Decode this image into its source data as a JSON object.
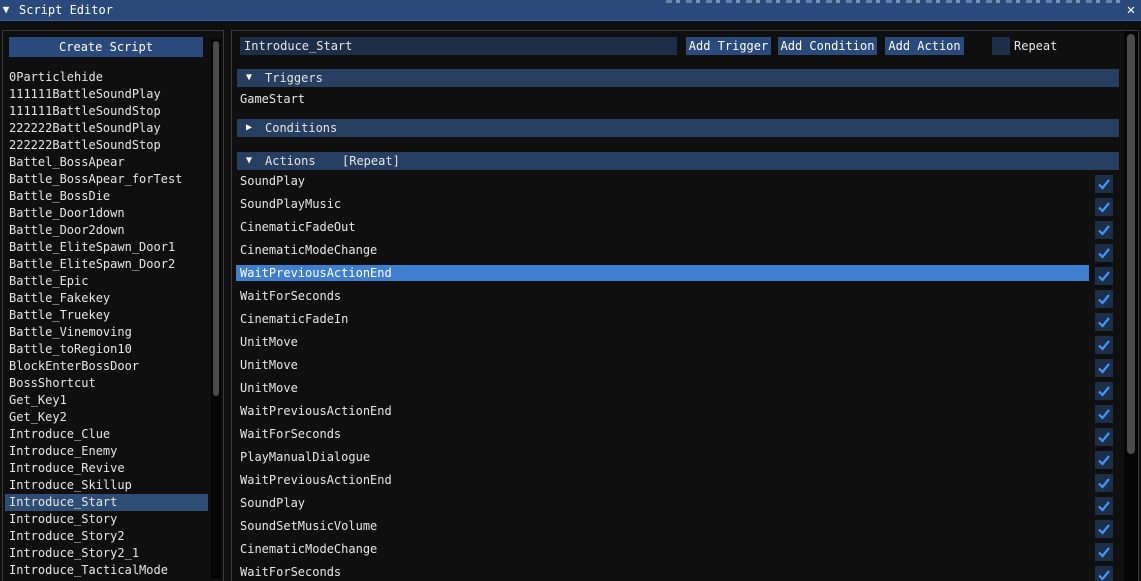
{
  "window": {
    "title": "Script Editor",
    "collapse_icon": "triangle-down",
    "close_icon": "x",
    "accent_color": "#294a7a"
  },
  "left": {
    "create_button": "Create Script",
    "scripts": [
      "0Particlehide",
      "111111BattleSoundPlay",
      "111111BattleSoundStop",
      "222222BattleSoundPlay",
      "222222BattleSoundStop",
      "Battel_BossApear",
      "Battle_BossApear_forTest",
      "Battle_BossDie",
      "Battle_Door1down",
      "Battle_Door2down",
      "Battle_EliteSpawn_Door1",
      "Battle_EliteSpawn_Door2",
      "Battle_Epic",
      "Battle_Fakekey",
      "Battle_Truekey",
      "Battle_Vinemoving",
      "Battle_toRegion10",
      "BlockEnterBossDoor",
      "BossShortcut",
      "Get_Key1",
      "Get_Key2",
      "Introduce_Clue",
      "Introduce_Enemy",
      "Introduce_Revive",
      "Introduce_Skillup",
      "Introduce_Start",
      "Introduce_Story",
      "Introduce_Story2",
      "Introduce_Story2_1",
      "Introduce_TacticalMode"
    ],
    "selected_script": "Introduce_Start"
  },
  "editor": {
    "script_name": "Introduce_Start",
    "add_trigger": "Add Trigger",
    "add_condition": "Add Condition",
    "add_action": "Add Action",
    "repeat_label": "Repeat",
    "repeat_checked": false,
    "triggers_header": "Triggers",
    "triggers": [
      "GameStart"
    ],
    "conditions_header": "Conditions",
    "actions_header": "Actions",
    "actions_repeat_tag": "[Repeat]",
    "selected_action": "WaitPreviousActionEnd",
    "actions": [
      {
        "name": "SoundPlay",
        "checked": true
      },
      {
        "name": "SoundPlayMusic",
        "checked": true
      },
      {
        "name": "CinematicFadeOut",
        "checked": true
      },
      {
        "name": "CinematicModeChange",
        "checked": true
      },
      {
        "name": "WaitPreviousActionEnd",
        "checked": true,
        "selected": true
      },
      {
        "name": "WaitForSeconds",
        "checked": true
      },
      {
        "name": "CinematicFadeIn",
        "checked": true
      },
      {
        "name": "UnitMove",
        "checked": true
      },
      {
        "name": "UnitMove",
        "checked": true
      },
      {
        "name": "UnitMove",
        "checked": true
      },
      {
        "name": "WaitPreviousActionEnd",
        "checked": true
      },
      {
        "name": "WaitForSeconds",
        "checked": true
      },
      {
        "name": "PlayManualDialogue",
        "checked": true
      },
      {
        "name": "WaitPreviousActionEnd",
        "checked": true
      },
      {
        "name": "SoundPlay",
        "checked": true
      },
      {
        "name": "SoundSetMusicVolume",
        "checked": true
      },
      {
        "name": "CinematicModeChange",
        "checked": true
      },
      {
        "name": "WaitForSeconds",
        "checked": true
      }
    ]
  }
}
